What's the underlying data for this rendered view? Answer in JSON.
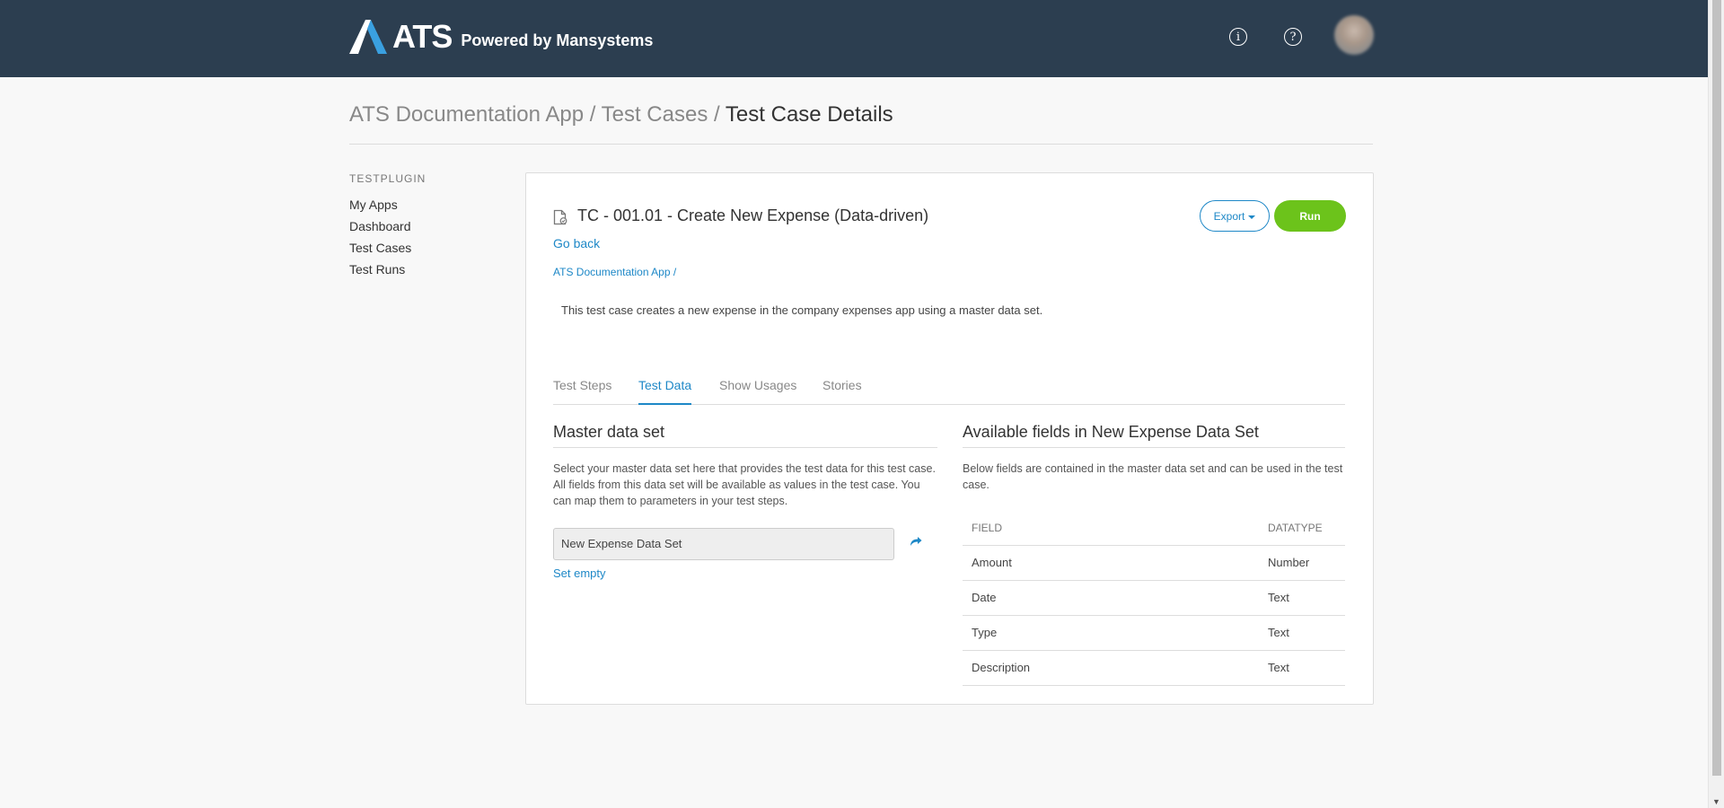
{
  "header": {
    "brand": "ATS",
    "tagline": "Powered by Mansystems",
    "info_glyph": "i",
    "help_glyph": "?"
  },
  "breadcrumb": {
    "app": "ATS Documentation App",
    "section": "Test Cases",
    "current": "Test Case Details",
    "separator": " / "
  },
  "sidebar": {
    "heading": "TESTPLUGIN",
    "items": [
      {
        "label": "My Apps"
      },
      {
        "label": "Dashboard"
      },
      {
        "label": "Test Cases"
      },
      {
        "label": "Test Runs"
      }
    ]
  },
  "test_case": {
    "title": "TC - 001.01  - Create New Expense (Data-driven)",
    "export_label": "Export",
    "run_label": "Run",
    "go_back": "Go back",
    "app_crumb": "ATS Documentation App /",
    "description": "This test case creates a new expense in the company expenses app using a master data set."
  },
  "tabs": [
    {
      "label": "Test Steps",
      "active": false
    },
    {
      "label": "Test Data",
      "active": true
    },
    {
      "label": "Show Usages",
      "active": false
    },
    {
      "label": "Stories",
      "active": false
    }
  ],
  "master_data": {
    "title": "Master data set",
    "help_line1": "Select your master data set here that provides the test data for this test case.",
    "help_line2": "All fields from this data set will be available as values in the test case. You can map them to parameters in your test steps.",
    "selected_value": "New Expense Data Set",
    "set_empty": "Set empty"
  },
  "available_fields": {
    "title": "Available fields in New Expense Data Set",
    "help": "Below fields are contained in the master data set and can be used in the test case.",
    "columns": [
      "FIELD",
      "DATATYPE"
    ],
    "rows": [
      {
        "field": "Amount",
        "datatype": "Number"
      },
      {
        "field": "Date",
        "datatype": "Text"
      },
      {
        "field": "Type",
        "datatype": "Text"
      },
      {
        "field": "Description",
        "datatype": "Text"
      }
    ]
  },
  "colors": {
    "header_bg": "#2c3e50",
    "link": "#1e88c7",
    "run_green": "#6cc31b"
  }
}
